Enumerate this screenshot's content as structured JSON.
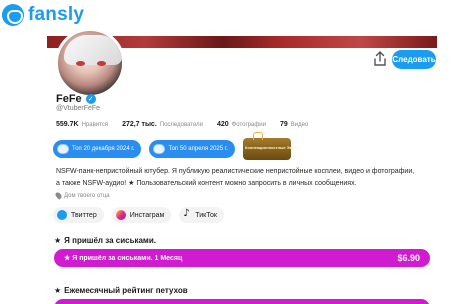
{
  "brand": {
    "name": "fansly",
    "accent": "#1a9cf0"
  },
  "profile": {
    "display_name": "FeFe",
    "handle": "@VtuberFeFe",
    "follow_label": "Следовать",
    "stats": [
      {
        "value": "559.7K",
        "label": "Нравится"
      },
      {
        "value": "272,7 тыс.",
        "label": "Последователи"
      },
      {
        "value": "420",
        "label": "Фотографии"
      },
      {
        "value": "79",
        "label": "Видео"
      }
    ],
    "badges": [
      {
        "label": "Топ 20 декабря 2024 г."
      },
      {
        "label": "Топ 50 апреля 2025 г."
      }
    ],
    "special_badge": {
      "line1": "Коннекционностные",
      "line2": "Эмоте"
    },
    "bio_line1": "NSFW-панк-непристойный ютубер. Я публикую реалистические непристойные косплеи, видео и фотографии,",
    "bio_line2": "а также NSFW-аудио! ★ Пользовательский контент можно запросить в личных сообщениях.",
    "joined": "Дом твоего отца",
    "socials": [
      {
        "label": "Твиттер"
      },
      {
        "label": "Инстаграм"
      },
      {
        "label": "ТикТок"
      }
    ]
  },
  "tiers": [
    {
      "title": "Я пришёл за сиськами.",
      "button_label": "★ Я пришёл за сиськами. 1 Месяц",
      "price": "$6.90"
    },
    {
      "title": "Ежемесячный рейтинг петухов"
    }
  ],
  "colors": {
    "tier_button": "#d11bd1",
    "badge": "#2a8ef0"
  }
}
